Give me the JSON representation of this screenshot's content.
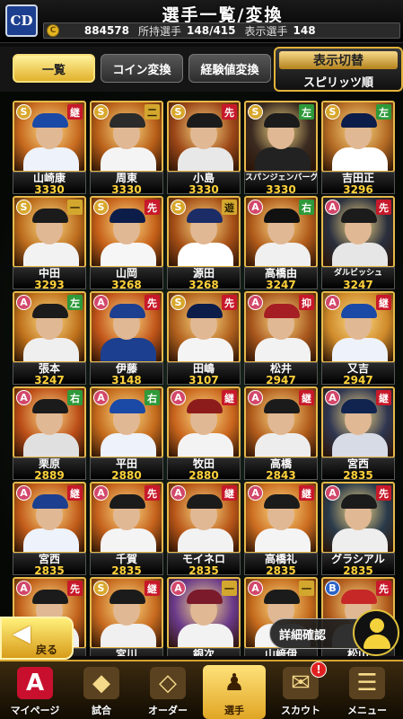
{
  "header": {
    "team_logo": "CD",
    "title": "選手一覧/変換",
    "coin_icon_glyph": "C",
    "coins": "884578",
    "owned_label": "所持選手",
    "owned_value": "148/415",
    "shown_label": "表示選手",
    "shown_value": "148"
  },
  "tabs": {
    "list": "一覧",
    "coin": "コイン変換",
    "exp": "経験値変換"
  },
  "display_toggle": {
    "title": "表示切替",
    "sort": "スピリッツ順"
  },
  "partial_top_row": [
    "3330",
    "3330",
    "3330",
    "3330",
    "3330"
  ],
  "players": [
    {
      "rarity": "S",
      "pos": "継",
      "pos_color": "red",
      "name": "山崎康",
      "value": "3330",
      "cap": "#1b49a6",
      "body": "#eef2fa",
      "bg": "#c76a1f"
    },
    {
      "rarity": "S",
      "pos": "二",
      "pos_color": "gold",
      "name": "周東",
      "value": "3330",
      "cap": "#2b2b2b",
      "body": "#f4f4f4",
      "bg": "#b85f18"
    },
    {
      "rarity": "S",
      "pos": "先",
      "pos_color": "red",
      "name": "小島",
      "value": "3330",
      "cap": "#1b1b1b",
      "body": "#e8e8e8",
      "bg": "#9c4718"
    },
    {
      "rarity": "S",
      "pos": "左",
      "pos_color": "green",
      "name": "スパンジェンバーグ",
      "value": "3330",
      "cap": "#1b1b1b",
      "body": "#222222",
      "bg": "#3a2a20"
    },
    {
      "rarity": "S",
      "pos": "左",
      "pos_color": "green",
      "name": "吉田正",
      "value": "3296",
      "cap": "#0c1d4a",
      "body": "#ffffff",
      "bg": "#b46b24"
    },
    {
      "rarity": "S",
      "pos": "一",
      "pos_color": "gold",
      "name": "中田",
      "value": "3293",
      "cap": "#1b1b1b",
      "body": "#f2f2f2",
      "bg": "#bc6c1c"
    },
    {
      "rarity": "S",
      "pos": "先",
      "pos_color": "red",
      "name": "山岡",
      "value": "3268",
      "cap": "#0c1d4a",
      "body": "#f6f6f6",
      "bg": "#c56018"
    },
    {
      "rarity": "S",
      "pos": "遊",
      "pos_color": "gold",
      "name": "源田",
      "value": "3268",
      "cap": "#1b2c66",
      "body": "#ffffff",
      "bg": "#a64f16"
    },
    {
      "rarity": "A",
      "pos": "右",
      "pos_color": "green",
      "name": "高橋由",
      "value": "3247",
      "cap": "#111111",
      "body": "#f0f0f0",
      "bg": "#b05a1a"
    },
    {
      "rarity": "A",
      "pos": "先",
      "pos_color": "red",
      "name": "ダルビッシュ",
      "value": "3247",
      "cap": "#1b1b1b",
      "body": "#e6e6e6",
      "bg": "#2a2f3d"
    },
    {
      "rarity": "A",
      "pos": "左",
      "pos_color": "green",
      "name": "張本",
      "value": "3247",
      "cap": "#1b1b1b",
      "body": "#efefef",
      "bg": "#c0721c"
    },
    {
      "rarity": "A",
      "pos": "先",
      "pos_color": "red",
      "name": "伊藤",
      "value": "3148",
      "cap": "#1c3f8f",
      "body": "#1c3f8f",
      "bg": "#c2561a"
    },
    {
      "rarity": "S",
      "pos": "先",
      "pos_color": "red",
      "name": "田嶋",
      "value": "3107",
      "cap": "#0c1d4a",
      "body": "#f4f4f4",
      "bg": "#b2621e"
    },
    {
      "rarity": "A",
      "pos": "抑",
      "pos_color": "red",
      "name": "松井",
      "value": "2947",
      "cap": "#a41e23",
      "body": "#f2f2f2",
      "bg": "#a8561c"
    },
    {
      "rarity": "A",
      "pos": "継",
      "pos_color": "red",
      "name": "又吉",
      "value": "2947",
      "cap": "#1b49a6",
      "body": "#eef2fa",
      "bg": "#cf8a2a"
    },
    {
      "rarity": "A",
      "pos": "右",
      "pos_color": "green",
      "name": "栗原",
      "value": "2889",
      "cap": "#1b1b1b",
      "body": "#e0e0e0",
      "bg": "#bc4e18"
    },
    {
      "rarity": "A",
      "pos": "右",
      "pos_color": "green",
      "name": "平田",
      "value": "2880",
      "cap": "#1b49a6",
      "body": "#eef2fa",
      "bg": "#c46a1c"
    },
    {
      "rarity": "A",
      "pos": "継",
      "pos_color": "red",
      "name": "牧田",
      "value": "2880",
      "cap": "#8c1c1c",
      "body": "#f3f3f3",
      "bg": "#c9651c"
    },
    {
      "rarity": "A",
      "pos": "継",
      "pos_color": "red",
      "name": "高橋",
      "value": "2843",
      "cap": "#1b1b1b",
      "body": "#ededed",
      "bg": "#b25c1c"
    },
    {
      "rarity": "A",
      "pos": "継",
      "pos_color": "red",
      "name": "宮西",
      "value": "2835",
      "cap": "#10244f",
      "body": "#d6dbe6",
      "bg": "#2f3650"
    },
    {
      "rarity": "A",
      "pos": "継",
      "pos_color": "red",
      "name": "宮西",
      "value": "2835",
      "cap": "#1c3f8f",
      "body": "#eef2fa",
      "bg": "#c25c1a"
    },
    {
      "rarity": "A",
      "pos": "先",
      "pos_color": "red",
      "name": "千賀",
      "value": "2835",
      "cap": "#1b1b1b",
      "body": "#f4f4f4",
      "bg": "#c5621c"
    },
    {
      "rarity": "A",
      "pos": "継",
      "pos_color": "red",
      "name": "モイネロ",
      "value": "2835",
      "cap": "#1b1b1b",
      "body": "#f2f2f2",
      "bg": "#b85618"
    },
    {
      "rarity": "A",
      "pos": "継",
      "pos_color": "red",
      "name": "高橋礼",
      "value": "2835",
      "cap": "#1b1b1b",
      "body": "#f4f4f4",
      "bg": "#cc6d20"
    },
    {
      "rarity": "A",
      "pos": "先",
      "pos_color": "red",
      "name": "グラシアル",
      "value": "2835",
      "cap": "#1b1b1b",
      "body": "#eeeeee",
      "bg": "#2a3a4a"
    },
    {
      "rarity": "A",
      "pos": "先",
      "pos_color": "red",
      "name": "",
      "value": "",
      "cap": "#1b1b1b",
      "body": "#f0f0f0",
      "bg": "#c2621c"
    },
    {
      "rarity": "S",
      "pos": "継",
      "pos_color": "red",
      "name": "宮川",
      "value": "",
      "cap": "#1b1b1b",
      "body": "#f0f0f0",
      "bg": "#c76a1f"
    },
    {
      "rarity": "A",
      "pos": "一",
      "pos_color": "gold",
      "name": "銀次",
      "value": "",
      "cap": "#7a1a2a",
      "body": "#f2f2f2",
      "bg": "#6b3a8a"
    },
    {
      "rarity": "A",
      "pos": "一",
      "pos_color": "gold",
      "name": "山﨑伊",
      "value": "",
      "cap": "#1b1b1b",
      "body": "#f4f4f4",
      "bg": "#c46a1c"
    },
    {
      "rarity": "B",
      "pos": "先",
      "pos_color": "red",
      "name": "松山",
      "value": "",
      "cap": "#c62828",
      "body": "#ffffff",
      "bg": "#b05a1c"
    }
  ],
  "back_button": {
    "label": "戻る",
    "arrow": "◀"
  },
  "detail_button": {
    "label": "詳細確認"
  },
  "nav": [
    {
      "label": "マイページ",
      "glyph": "A",
      "icon": "a-logo-icon",
      "active": false,
      "badge": ""
    },
    {
      "label": "試合",
      "glyph": "◆",
      "icon": "stadium-icon",
      "active": false,
      "badge": ""
    },
    {
      "label": "オーダー",
      "glyph": "◇",
      "icon": "diamond-field-icon",
      "active": false,
      "badge": ""
    },
    {
      "label": "選手",
      "glyph": "♟",
      "icon": "player-icon",
      "active": true,
      "badge": ""
    },
    {
      "label": "スカウト",
      "glyph": "✉",
      "icon": "scout-icon",
      "active": false,
      "badge": "!"
    },
    {
      "label": "メニュー",
      "glyph": "☰",
      "icon": "menu-icon",
      "active": false,
      "badge": ""
    }
  ],
  "colors": {
    "accent_gold": "#e6b94a",
    "value_yellow": "#ffd23a",
    "pos_red": "#c7192a",
    "pos_green": "#2e9a3a"
  }
}
